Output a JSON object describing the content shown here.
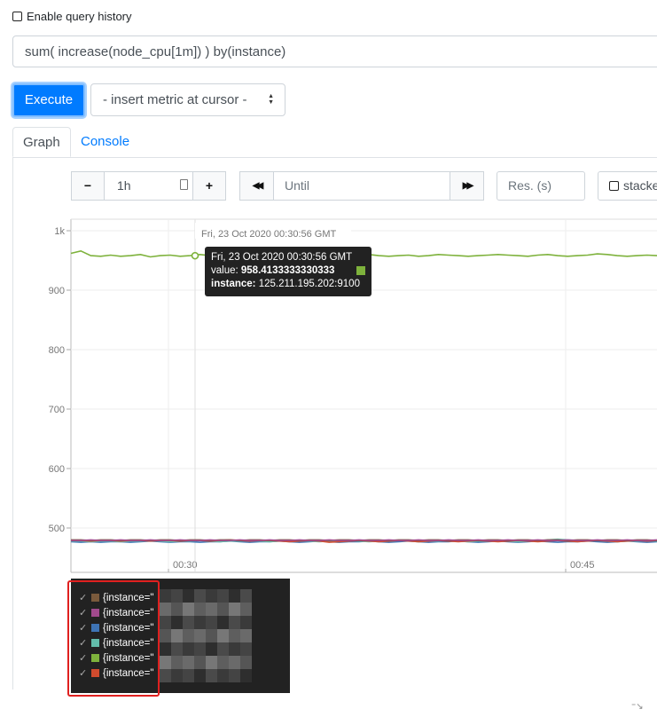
{
  "query_history": {
    "label": "Enable query history",
    "checked": false
  },
  "query": {
    "value": "sum( increase(node_cpu[1m]) ) by(instance)"
  },
  "execute_label": "Execute",
  "metric_select": {
    "selected": "- insert metric at cursor -"
  },
  "tabs": [
    {
      "label": "Graph",
      "active": true
    },
    {
      "label": "Console",
      "active": false
    }
  ],
  "controls": {
    "minus": "−",
    "range": "1h",
    "plus": "+",
    "back": "◀◀",
    "until_placeholder": "Until",
    "forward": "▶▶",
    "res_placeholder": "Res. (s)",
    "stacked_label": "stacked"
  },
  "chart_data": {
    "type": "line",
    "y_ticks": [
      "1k",
      "900",
      "800",
      "700",
      "600",
      "500"
    ],
    "ylim": [
      480,
      1000
    ],
    "x_ticks": [
      "00:30",
      "00:45"
    ],
    "hover_time": "Fri, 23 Oct 2020 00:30:56 GMT",
    "series": [
      {
        "color": "#7eb23c",
        "values": [
          962,
          966,
          958,
          957,
          959,
          957,
          958,
          960,
          956,
          958,
          959,
          957,
          958,
          960,
          958,
          957,
          959,
          958,
          957,
          959,
          958,
          960,
          958,
          957,
          959,
          958,
          957,
          956,
          958,
          959,
          960,
          958,
          957,
          958,
          959,
          957,
          958,
          960,
          959,
          958,
          957,
          958,
          959,
          960,
          959,
          958,
          957,
          959,
          960,
          958,
          957,
          958,
          959,
          961,
          960,
          958,
          957,
          958,
          959,
          958
        ]
      },
      {
        "color": "#3e74b5",
        "values": [
          477,
          476,
          477,
          476,
          477,
          477,
          476,
          477,
          478,
          477,
          476,
          477,
          477,
          476,
          477,
          477,
          478,
          477,
          476,
          477,
          477,
          478,
          477,
          476,
          477,
          478,
          477,
          476,
          477,
          477,
          478,
          477,
          476,
          477,
          478,
          477,
          476,
          477,
          477,
          478,
          477,
          476,
          477,
          478,
          477,
          476,
          477,
          478,
          477,
          476,
          477,
          477,
          478,
          477,
          476,
          477,
          478,
          477,
          476,
          477
        ]
      },
      {
        "color": "#62bcaa",
        "values": [
          478,
          478,
          477,
          478,
          478,
          477,
          478,
          478,
          479,
          478,
          477,
          478,
          478,
          479,
          478,
          477,
          478,
          478,
          479,
          478,
          477,
          478,
          478,
          479,
          478,
          477,
          478,
          478,
          479,
          478,
          477,
          478,
          478,
          479,
          478,
          477,
          478,
          478,
          479,
          478,
          477,
          478,
          478,
          479,
          478,
          477,
          478,
          478,
          480,
          481,
          480,
          479,
          478,
          479,
          478,
          477,
          478,
          478,
          479,
          478
        ]
      },
      {
        "color": "#d04b2e",
        "values": [
          479,
          479,
          478,
          479,
          479,
          478,
          479,
          479,
          478,
          479,
          479,
          478,
          479,
          479,
          478,
          479,
          480,
          479,
          478,
          479,
          479,
          478,
          477,
          478,
          479,
          478,
          476,
          477,
          478,
          479,
          478,
          477,
          478,
          479,
          478,
          477,
          478,
          479,
          478,
          477,
          478,
          479,
          478,
          477,
          478,
          479,
          478,
          477,
          478,
          479,
          478,
          477,
          478,
          479,
          478,
          477,
          478,
          479,
          478,
          479
        ]
      },
      {
        "color": "#7a5a3c",
        "values": [
          480,
          480,
          479,
          480,
          480,
          479,
          480,
          480,
          479,
          480,
          480,
          479,
          480,
          480,
          479,
          480,
          480,
          479,
          480,
          480,
          479,
          480,
          480,
          479,
          480,
          480,
          479,
          480,
          480,
          479,
          480,
          480,
          479,
          480,
          480,
          479,
          480,
          480,
          479,
          480,
          480,
          479,
          480,
          480,
          479,
          480,
          480,
          479,
          480,
          480,
          479,
          480,
          480,
          479,
          480,
          480,
          479,
          480,
          480,
          479
        ]
      },
      {
        "color": "#a14a8c",
        "values": [
          479,
          479,
          480,
          479,
          479,
          480,
          479,
          479,
          480,
          479,
          479,
          480,
          479,
          479,
          480,
          479,
          479,
          480,
          479,
          479,
          480,
          479,
          479,
          480,
          479,
          479,
          480,
          479,
          479,
          480,
          479,
          479,
          480,
          479,
          479,
          480,
          479,
          479,
          480,
          479,
          479,
          480,
          479,
          479,
          480,
          479,
          479,
          480,
          479,
          479,
          480,
          479,
          479,
          480,
          479,
          479,
          480,
          479,
          479,
          480
        ]
      }
    ]
  },
  "tooltip": {
    "time": "Fri, 23 Oct 2020 00:30:56 GMT",
    "value_key": "value:",
    "value": "958.4133333330333",
    "instance_key": "instance:",
    "instance": "125.211.195.202:9100",
    "color": "#7eb23c"
  },
  "legend": [
    {
      "label": "{instance=\"",
      "color": "#7a5a3c"
    },
    {
      "label": "{instance=\"",
      "color": "#a14a8c"
    },
    {
      "label": "{instance=\"",
      "color": "#3e74b5"
    },
    {
      "label": "{instance=\"",
      "color": "#62bcaa"
    },
    {
      "label": "{instance=\"",
      "color": "#7eb23c"
    },
    {
      "label": "{instance=\"",
      "color": "#d04b2e"
    }
  ],
  "corner_icon": "resize-icon"
}
